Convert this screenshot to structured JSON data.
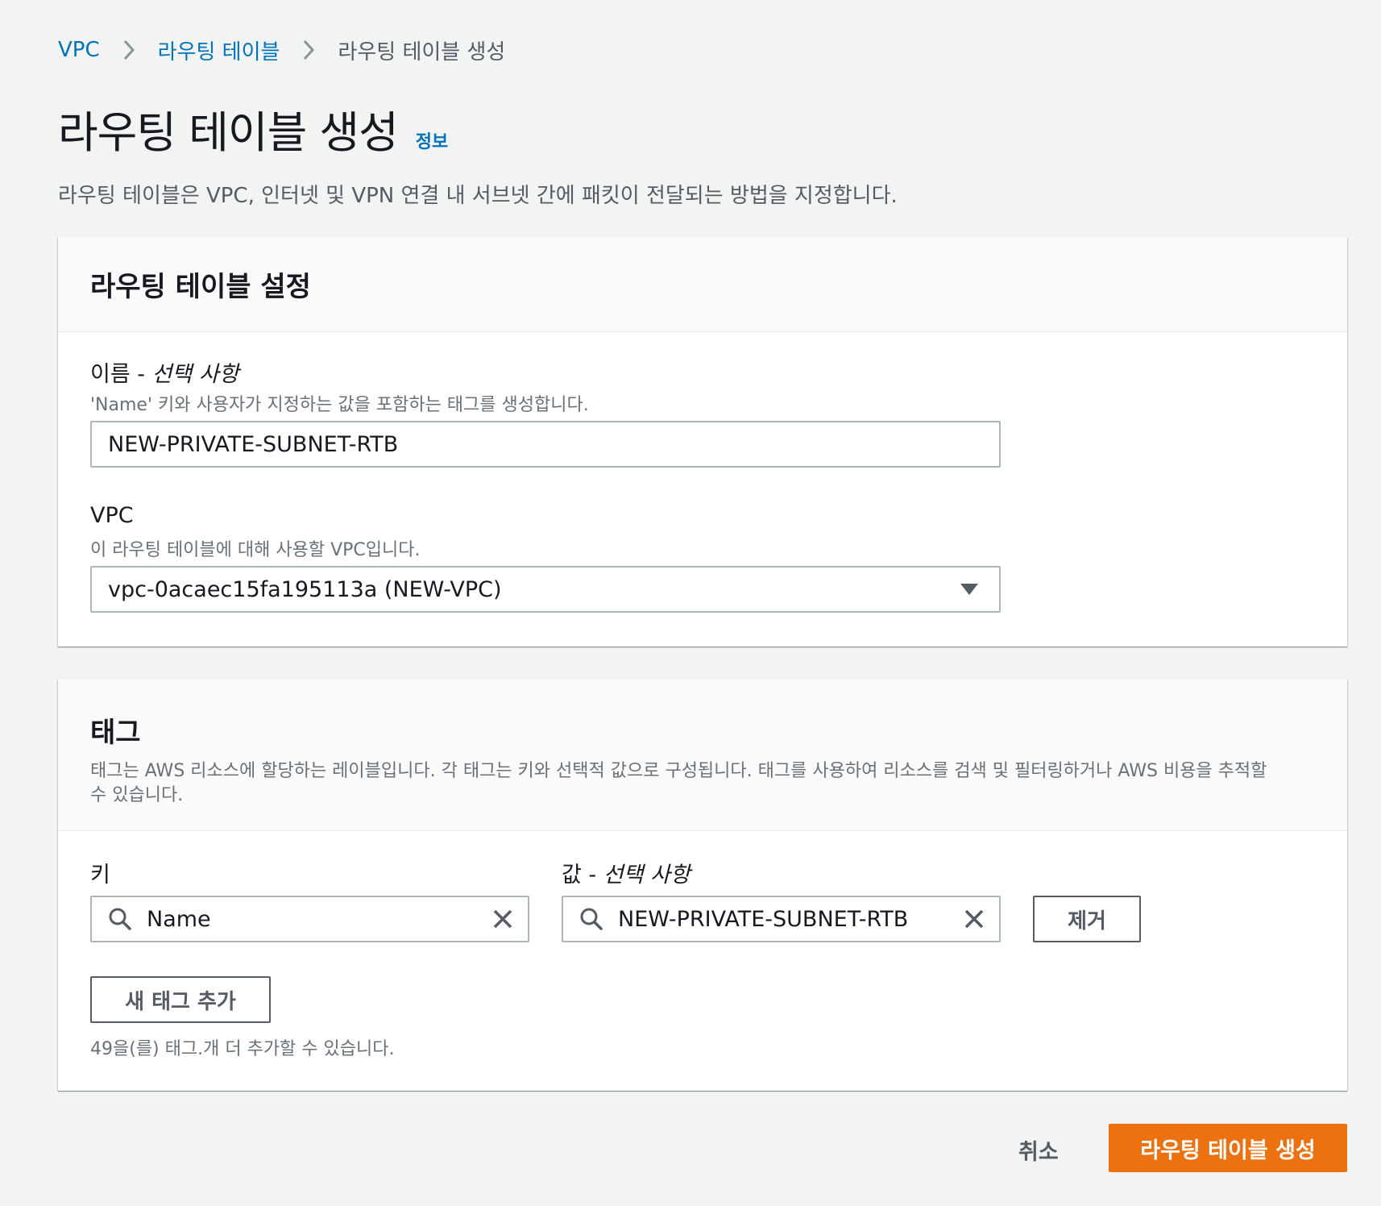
{
  "breadcrumb": {
    "items": [
      {
        "label": "VPC"
      },
      {
        "label": "라우팅 테이블"
      },
      {
        "label": "라우팅 테이블 생성"
      }
    ]
  },
  "page": {
    "title": "라우팅 테이블 생성",
    "info_label": "정보",
    "description": "라우팅 테이블은 VPC, 인터넷 및 VPN 연결 내 서브넷 간에 패킷이 전달되는 방법을 지정합니다."
  },
  "settings": {
    "title": "라우팅 테이블 설정",
    "name_label": "이름 - ",
    "name_optional": "선택 사항",
    "name_desc": "'Name' 키와 사용자가 지정하는 값을 포함하는 태그를 생성합니다.",
    "name_value": "NEW-PRIVATE-SUBNET-RTB",
    "vpc_label": "VPC",
    "vpc_desc": "이 라우팅 테이블에 대해 사용할 VPC입니다.",
    "vpc_value": "vpc-0acaec15fa195113a (NEW-VPC)"
  },
  "tags": {
    "title": "태그",
    "description": "태그는 AWS 리소스에 할당하는 레이블입니다. 각 태그는 키와 선택적 값으로 구성됩니다. 태그를 사용하여 리소스를 검색 및 필터링하거나 AWS 비용을 추적할 수 있습니다.",
    "key_label": "키",
    "value_label": "값 - ",
    "value_optional": "선택 사항",
    "rows": [
      {
        "key": "Name",
        "value": "NEW-PRIVATE-SUBNET-RTB"
      }
    ],
    "remove_label": "제거",
    "add_label": "새 태그 추가",
    "limit_text": "49을(를) 태그.개 더 추가할 수 있습니다."
  },
  "footer": {
    "cancel_label": "취소",
    "submit_label": "라우팅 테이블 생성"
  },
  "colors": {
    "link": "#0073bb",
    "primary": "#ec7211",
    "background": "#f2f3f3"
  },
  "icons": [
    "chevron-right-icon",
    "search-icon",
    "close-icon",
    "caret-down-icon"
  ]
}
